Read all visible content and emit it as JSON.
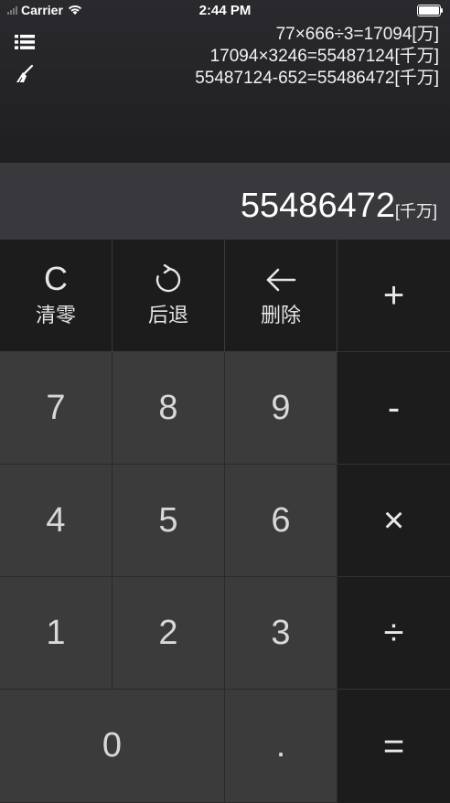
{
  "status_bar": {
    "carrier": "Carrier",
    "time": "2:44 PM"
  },
  "toolbar": {
    "list_icon": "list-icon",
    "clear_history_icon": "broom-icon"
  },
  "history": [
    "77×666÷3=17094[万]",
    "17094×3246=55487124[千万]",
    "55487124-652=55486472[千万]"
  ],
  "display": {
    "value": "55486472",
    "unit": "[千万]"
  },
  "keys": {
    "clear": {
      "label": "清零",
      "icon": "C"
    },
    "back": {
      "label": "后退",
      "icon": "undo-arrow-icon"
    },
    "delete": {
      "label": "删除",
      "icon": "left-arrow-icon"
    },
    "plus": "+",
    "minus": "-",
    "multiply": "×",
    "divide": "÷",
    "equals": "=",
    "digits": [
      "0",
      "1",
      "2",
      "3",
      "4",
      "5",
      "6",
      "7",
      "8",
      "9"
    ],
    "dot": "."
  }
}
